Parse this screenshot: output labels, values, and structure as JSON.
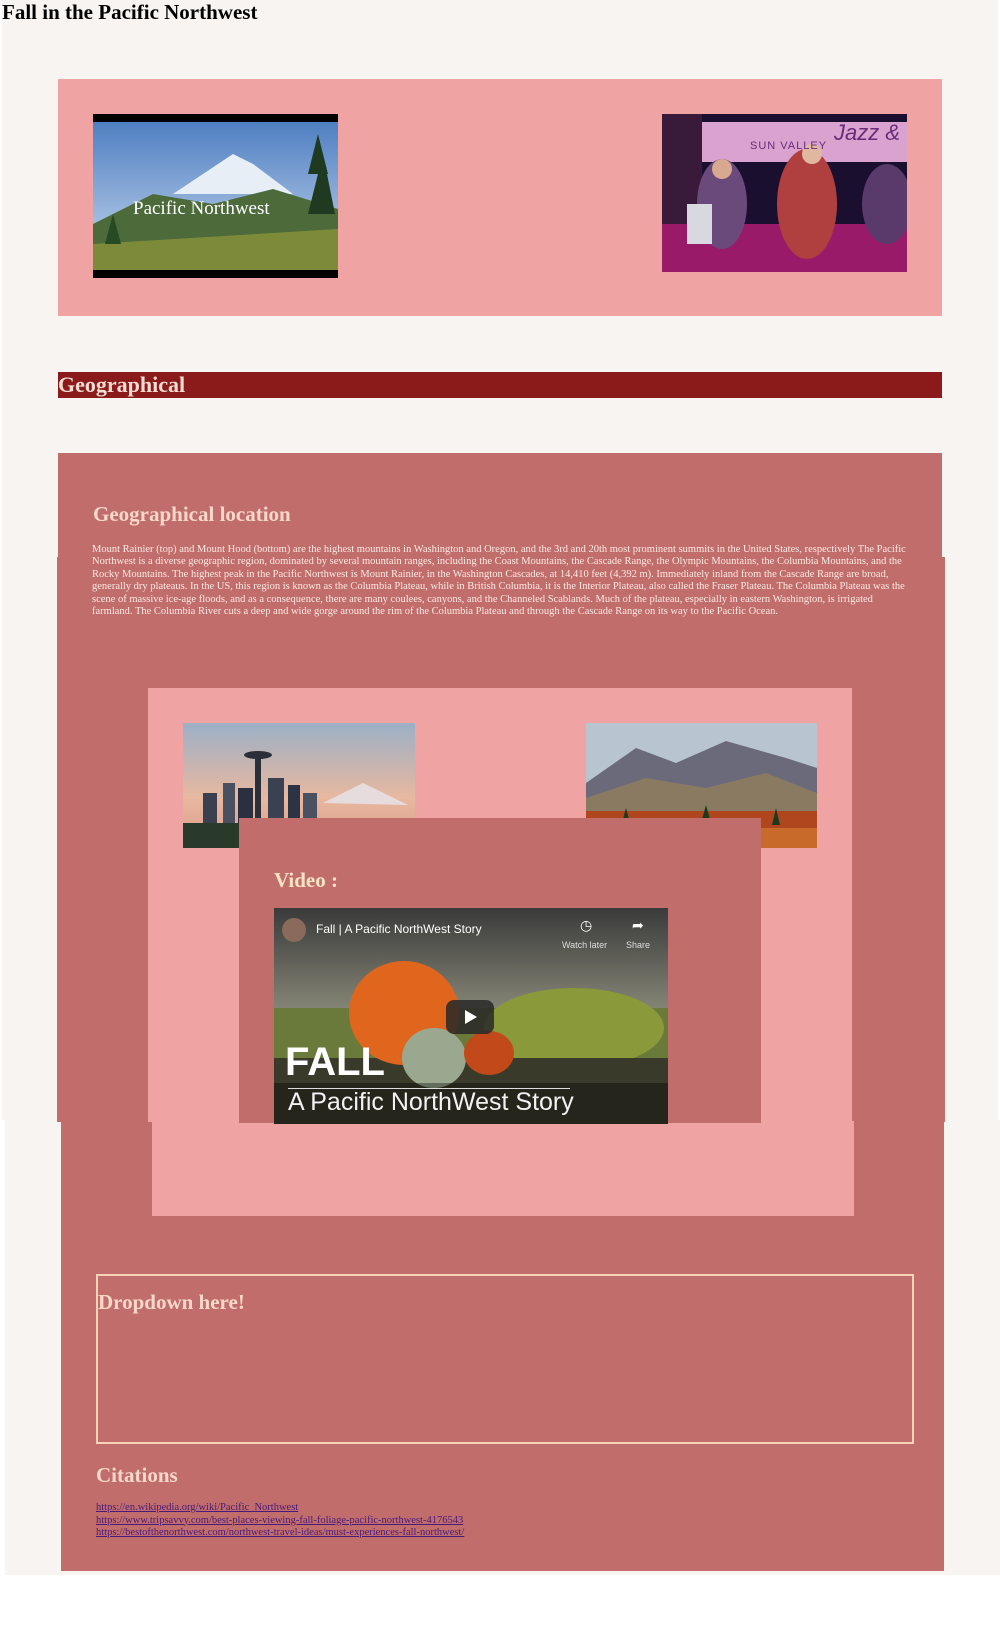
{
  "page": {
    "title": "Fall in the Pacific Northwest"
  },
  "header_images": {
    "left": {
      "name": "pacific-northwest-photo",
      "caption": "Pacific Northwest"
    },
    "right": {
      "name": "jazz-band-photo",
      "sign_text": "Jazz &",
      "sign_subtext": "SUN VALLEY"
    }
  },
  "geographical": {
    "bar_label": "Geographical",
    "heading": "Geographical location",
    "paragraph": "Mount Rainier (top) and Mount Hood (bottom) are the highest mountains in Washington and Oregon, and the 3rd and 20th most prominent summits in the United States, respectively The Pacific Northwest is a diverse geographic region, dominated by several mountain ranges, including the Coast Mountains, the Cascade Range, the Olympic Mountains, the Columbia Mountains, and the Rocky Mountains. The highest peak in the Pacific Northwest is Mount Rainier, in the Washington Cascades, at 14,410 feet (4,392 m). Immediately inland from the Cascade Range are broad, generally dry plateaus. In the US, this region is known as the Columbia Plateau, while in British Columbia, it is the Interior Plateau, also called the Fraser Plateau. The Columbia Plateau was the scene of massive ice-age floods, and as a consequence, there are many coulees, canyons, and the Channeled Scablands. Much of the plateau, especially in eastern Washington, is irrigated farmland. The Columbia River cuts a deep and wide gorge around the rim of the Columbia Plateau and through the Cascade Range on its way to the Pacific Ocean."
  },
  "video": {
    "label": "Video :",
    "player_title": "Fall | A Pacific NorthWest Story",
    "watch_later": "Watch later",
    "share": "Share",
    "overlay_big": "FALL",
    "overlay_sub": "A Pacific NorthWest Story"
  },
  "dropdown": {
    "label": "Dropdown here!"
  },
  "citations": {
    "heading": "Citations",
    "links": [
      "https://en.wikipedia.org/wiki/Pacific_Northwest",
      "https://www.tripsavvy.com/best-places-viewing-fall-foliage-pacific-northwest-4176543",
      "https://bestofthenorthwest.com/northwest-travel-ideas/must-experiences-fall-northwest/"
    ]
  },
  "colors": {
    "page_bg": "#f8f4f2",
    "pink": "#f0a3a3",
    "rose": "#c06d6c",
    "dark_red": "#8b1a1a",
    "heading_text": "#f8d8c8",
    "link": "#4a1a7a"
  }
}
